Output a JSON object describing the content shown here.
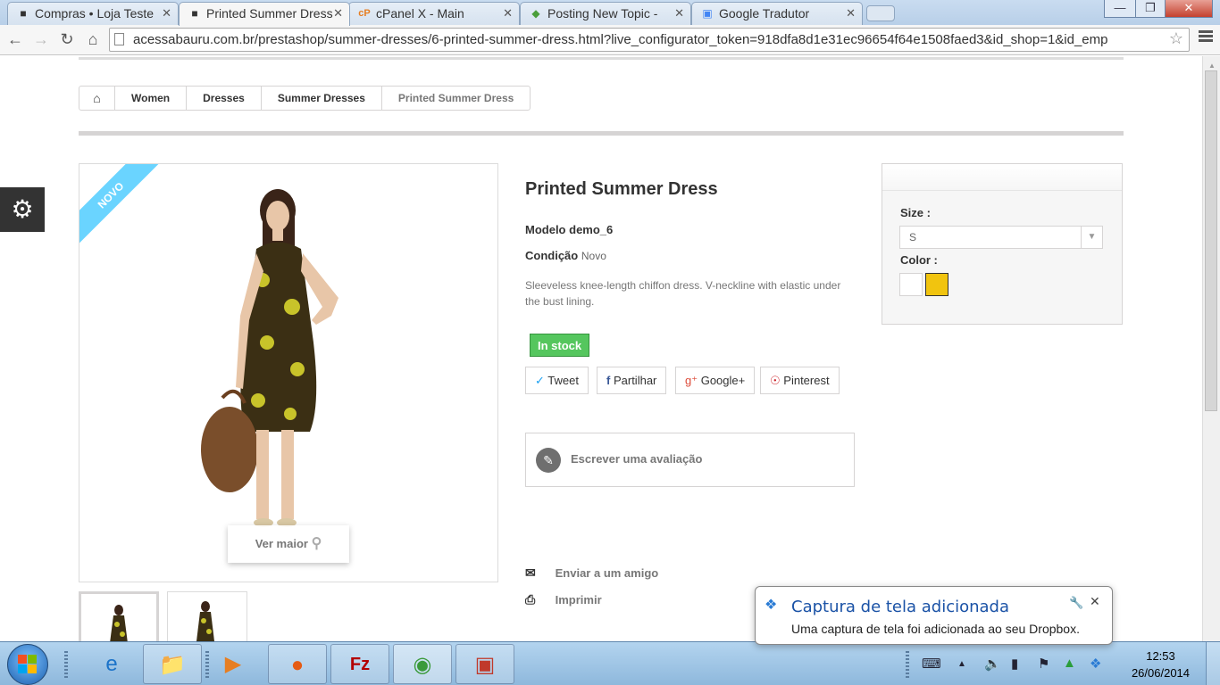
{
  "browser": {
    "tabs": [
      {
        "title": "Compras • Loja Teste",
        "favicon": "prestashop-icon"
      },
      {
        "title": "Printed Summer Dress",
        "favicon": "prestashop-icon"
      },
      {
        "title": "cPanel X - Main",
        "favicon": "cpanel-icon"
      },
      {
        "title": "Posting New Topic -",
        "favicon": "forum-icon"
      },
      {
        "title": "Google Tradutor",
        "favicon": "google-translate-icon"
      }
    ],
    "url": "acessabauru.com.br/prestashop/summer-dresses/6-printed-summer-dress.html?live_configurator_token=918dfa8d1e31ec96654f64e1508faed3&id_shop=1&id_emp"
  },
  "breadcrumb": [
    "Women",
    "Dresses",
    "Summer Dresses",
    "Printed Summer Dress"
  ],
  "product": {
    "badge": "NOVO",
    "zoom_label": "Ver maior",
    "title": "Printed Summer Dress",
    "reference_label": "Modelo",
    "reference": "demo_6",
    "condition_label": "Condição",
    "condition": "Novo",
    "description": "Sleeveless knee-length chiffon dress. V-neckline with elastic under the bust lining.",
    "stock": "In stock",
    "social": [
      "Tweet",
      "Partilhar",
      "Google+",
      "Pinterest"
    ],
    "review": "Escrever uma avaliação",
    "send_friend": "Enviar a um amigo",
    "print": "Imprimir"
  },
  "options": {
    "size_label": "Size :",
    "size_value": "S",
    "color_label": "Color :",
    "colors": [
      "#ffffff",
      "#f1c40f"
    ]
  },
  "dropbox": {
    "title": "Captura de tela adicionada",
    "message": "Uma captura de tela foi adicionada ao seu Dropbox."
  },
  "taskbar": {
    "time": "12:53",
    "date": "26/06/2014"
  }
}
